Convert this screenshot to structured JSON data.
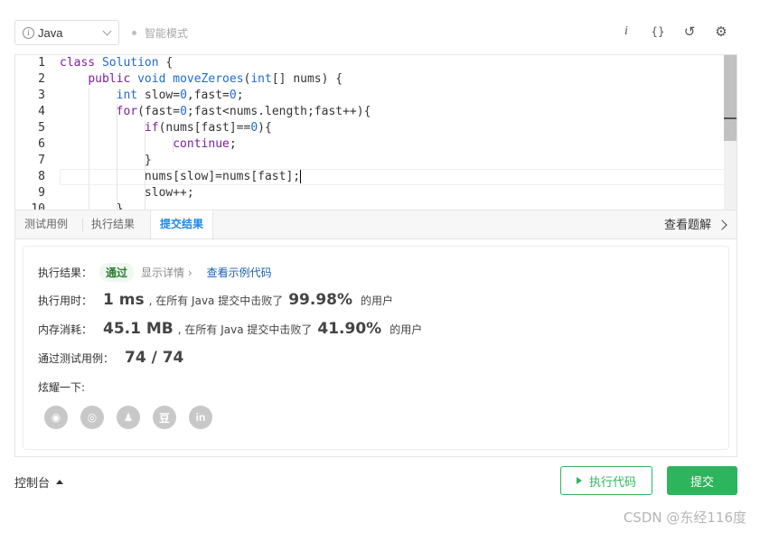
{
  "toolbar": {
    "language": "Java",
    "smart_mode": "智能模式",
    "icons": [
      "info-italic-icon",
      "braces-icon",
      "undo-icon",
      "settings-icon"
    ],
    "icon_glyphs": [
      "i",
      "{}",
      "↺",
      "⚙"
    ]
  },
  "editor": {
    "line_numbers": [
      "1",
      "2",
      "3",
      "4",
      "5",
      "6",
      "7",
      "8",
      "9",
      "10"
    ],
    "current_line": 8
  },
  "tabs": {
    "items": [
      "测试用例",
      "执行结果",
      "提交结果"
    ],
    "active": "提交结果",
    "view_problem": "查看题解"
  },
  "result": {
    "status_label": "执行结果：",
    "status": "通过",
    "show_detail": "显示详情 ›",
    "view_example": "查看示例代码",
    "runtime_label": "执行用时：",
    "runtime_value": "1 ms",
    "runtime_middle": ", 在所有 Java 提交中击败了",
    "runtime_percent": "99.98%",
    "runtime_suffix": "的用户",
    "memory_label": "内存消耗：",
    "memory_value": "45.1 MB",
    "memory_middle": ", 在所有 Java 提交中击败了",
    "memory_percent": "41.90%",
    "memory_suffix": "的用户",
    "tests_label": "通过测试用例：",
    "tests_value": "74 / 74",
    "share_label": "炫耀一下:",
    "share_icons": [
      "wechat-icon",
      "weibo-icon",
      "qq-icon",
      "douban-icon",
      "linkedin-icon"
    ],
    "share_glyphs": [
      "◉",
      "◎",
      "♟",
      "豆",
      "in"
    ]
  },
  "footer": {
    "console": "控制台",
    "run": "执行代码",
    "submit": "提交"
  },
  "watermark": "CSDN @东经116度",
  "colors": {
    "accent_green": "#2db55d",
    "tab_active_blue": "#1e88e5",
    "link_blue": "#1a5fb4"
  }
}
